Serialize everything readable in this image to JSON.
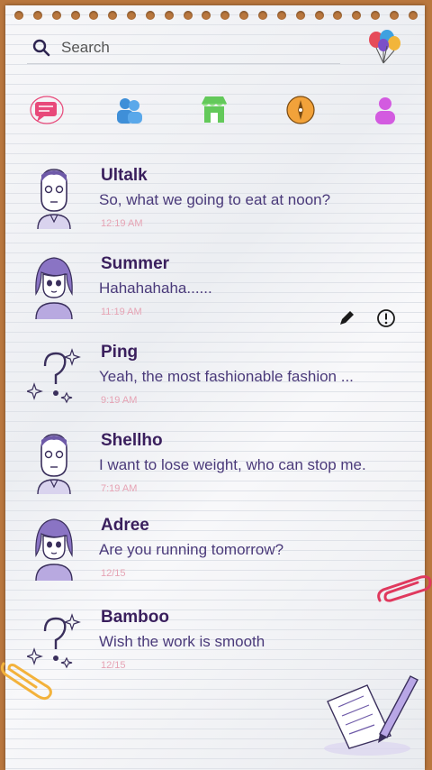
{
  "search": {
    "placeholder": "Search"
  },
  "tabs": [
    {
      "name": "messages",
      "icon": "chat-bubble-icon",
      "color": "#e8497a"
    },
    {
      "name": "contacts",
      "icon": "people-icon",
      "color": "#3f8fd8"
    },
    {
      "name": "store",
      "icon": "shop-icon",
      "color": "#63c95a"
    },
    {
      "name": "discover",
      "icon": "compass-icon",
      "color": "#f2a23a"
    },
    {
      "name": "profile",
      "icon": "person-icon",
      "color": "#d35be0"
    }
  ],
  "chats": [
    {
      "name": "Ultalk",
      "message": "So, what we going to eat at noon?",
      "time": "12:19 AM",
      "avatar": "boy"
    },
    {
      "name": "Summer",
      "message": "Hahahahaha......",
      "time": "11:19 AM",
      "avatar": "girl"
    },
    {
      "name": "Ping",
      "message": "Yeah, the most fashionable fashion ...",
      "time": "9:19 AM",
      "avatar": "question"
    },
    {
      "name": "Shellho",
      "message": "I want to lose weight, who can stop me.",
      "time": "7:19 AM",
      "avatar": "boy"
    },
    {
      "name": "Adree",
      "message": "Are you running tomorrow?",
      "time": "12/15",
      "avatar": "girl"
    },
    {
      "name": "Bamboo",
      "message": "Wish the work is smooth",
      "time": "12/15",
      "avatar": "question"
    }
  ],
  "colors": {
    "name": "#3a1f5d",
    "message": "#4a3a7a",
    "time": "#e6a3b4",
    "wood": "#b9773e"
  }
}
